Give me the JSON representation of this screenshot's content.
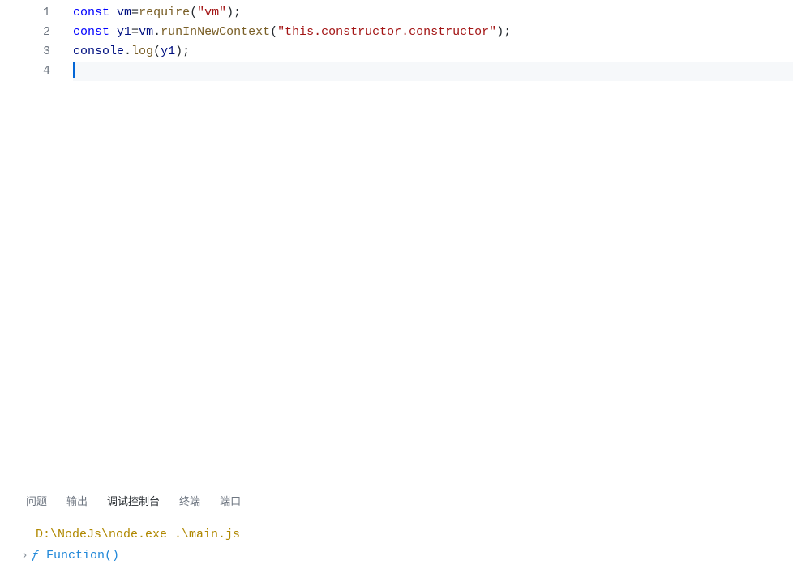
{
  "editor": {
    "lines": [
      {
        "num": "1",
        "tokens": [
          {
            "cls": "tok-kw",
            "t": "const"
          },
          {
            "cls": "",
            "t": " "
          },
          {
            "cls": "tok-var",
            "t": "vm"
          },
          {
            "cls": "tok-punct",
            "t": "="
          },
          {
            "cls": "tok-fn",
            "t": "require"
          },
          {
            "cls": "tok-punct",
            "t": "("
          },
          {
            "cls": "tok-str",
            "t": "\"vm\""
          },
          {
            "cls": "tok-punct",
            "t": ");"
          }
        ]
      },
      {
        "num": "2",
        "tokens": [
          {
            "cls": "tok-kw",
            "t": "const"
          },
          {
            "cls": "",
            "t": " "
          },
          {
            "cls": "tok-var",
            "t": "y1"
          },
          {
            "cls": "tok-punct",
            "t": "="
          },
          {
            "cls": "tok-obj",
            "t": "vm"
          },
          {
            "cls": "tok-punct",
            "t": "."
          },
          {
            "cls": "tok-fn",
            "t": "runInNewContext"
          },
          {
            "cls": "tok-punct",
            "t": "("
          },
          {
            "cls": "tok-str",
            "t": "\"this.constructor.constructor\""
          },
          {
            "cls": "tok-punct",
            "t": ");"
          }
        ]
      },
      {
        "num": "3",
        "tokens": [
          {
            "cls": "tok-obj",
            "t": "console"
          },
          {
            "cls": "tok-punct",
            "t": "."
          },
          {
            "cls": "tok-fn",
            "t": "log"
          },
          {
            "cls": "tok-punct",
            "t": "("
          },
          {
            "cls": "tok-var",
            "t": "y1"
          },
          {
            "cls": "tok-punct",
            "t": ");"
          }
        ]
      },
      {
        "num": "4",
        "tokens": []
      }
    ],
    "active_line_index": 3
  },
  "panel": {
    "tabs": [
      {
        "id": "problems",
        "label": "问题"
      },
      {
        "id": "output",
        "label": "输出"
      },
      {
        "id": "debug-console",
        "label": "调试控制台"
      },
      {
        "id": "terminal",
        "label": "终端"
      },
      {
        "id": "ports",
        "label": "端口"
      }
    ],
    "active_tab": "debug-console",
    "console": {
      "command": "D:\\NodeJs\\node.exe .\\main.js",
      "output_prefix": "ƒ",
      "output_text": "Function()",
      "chevron": "›"
    }
  }
}
